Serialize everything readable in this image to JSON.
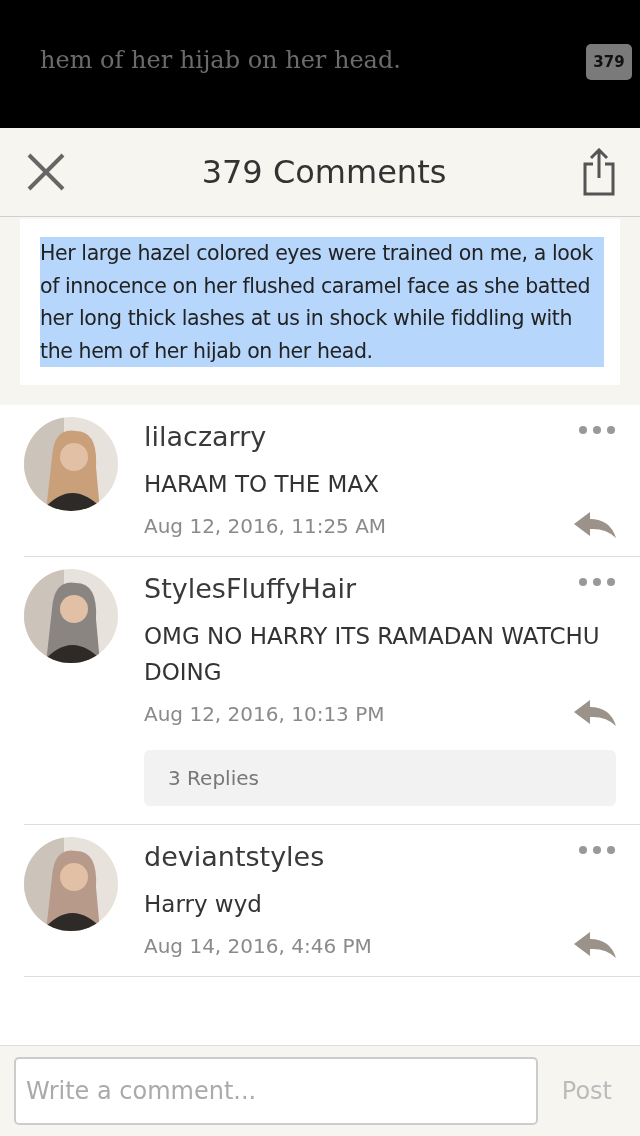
{
  "top_bar": {
    "text": "hem of her hijab on her head.",
    "comment_count": "379"
  },
  "header": {
    "title": "379 Comments"
  },
  "quote": {
    "text": "Her large hazel colored eyes were trained on me, a look of innocence on her flushed caramel face as she batted her long thick lashes at us in shock while fiddling with the hem of her hijab on her head."
  },
  "comments": [
    {
      "user": "lilaczarry",
      "text": "HARAM TO THE MAX",
      "date": "Aug 12, 2016, 11:25 AM"
    },
    {
      "user": "StylesFluffyHair",
      "text": "OMG NO HARRY ITS RAMADAN WATCHU DOING",
      "date": "Aug 12, 2016, 10:13 PM",
      "replies": "3 Replies"
    },
    {
      "user": "deviantstyles",
      "text": "Harry wyd",
      "date": "Aug 14, 2016, 4:46 PM"
    }
  ],
  "composer": {
    "placeholder": "Write a comment...",
    "button": "Post"
  }
}
